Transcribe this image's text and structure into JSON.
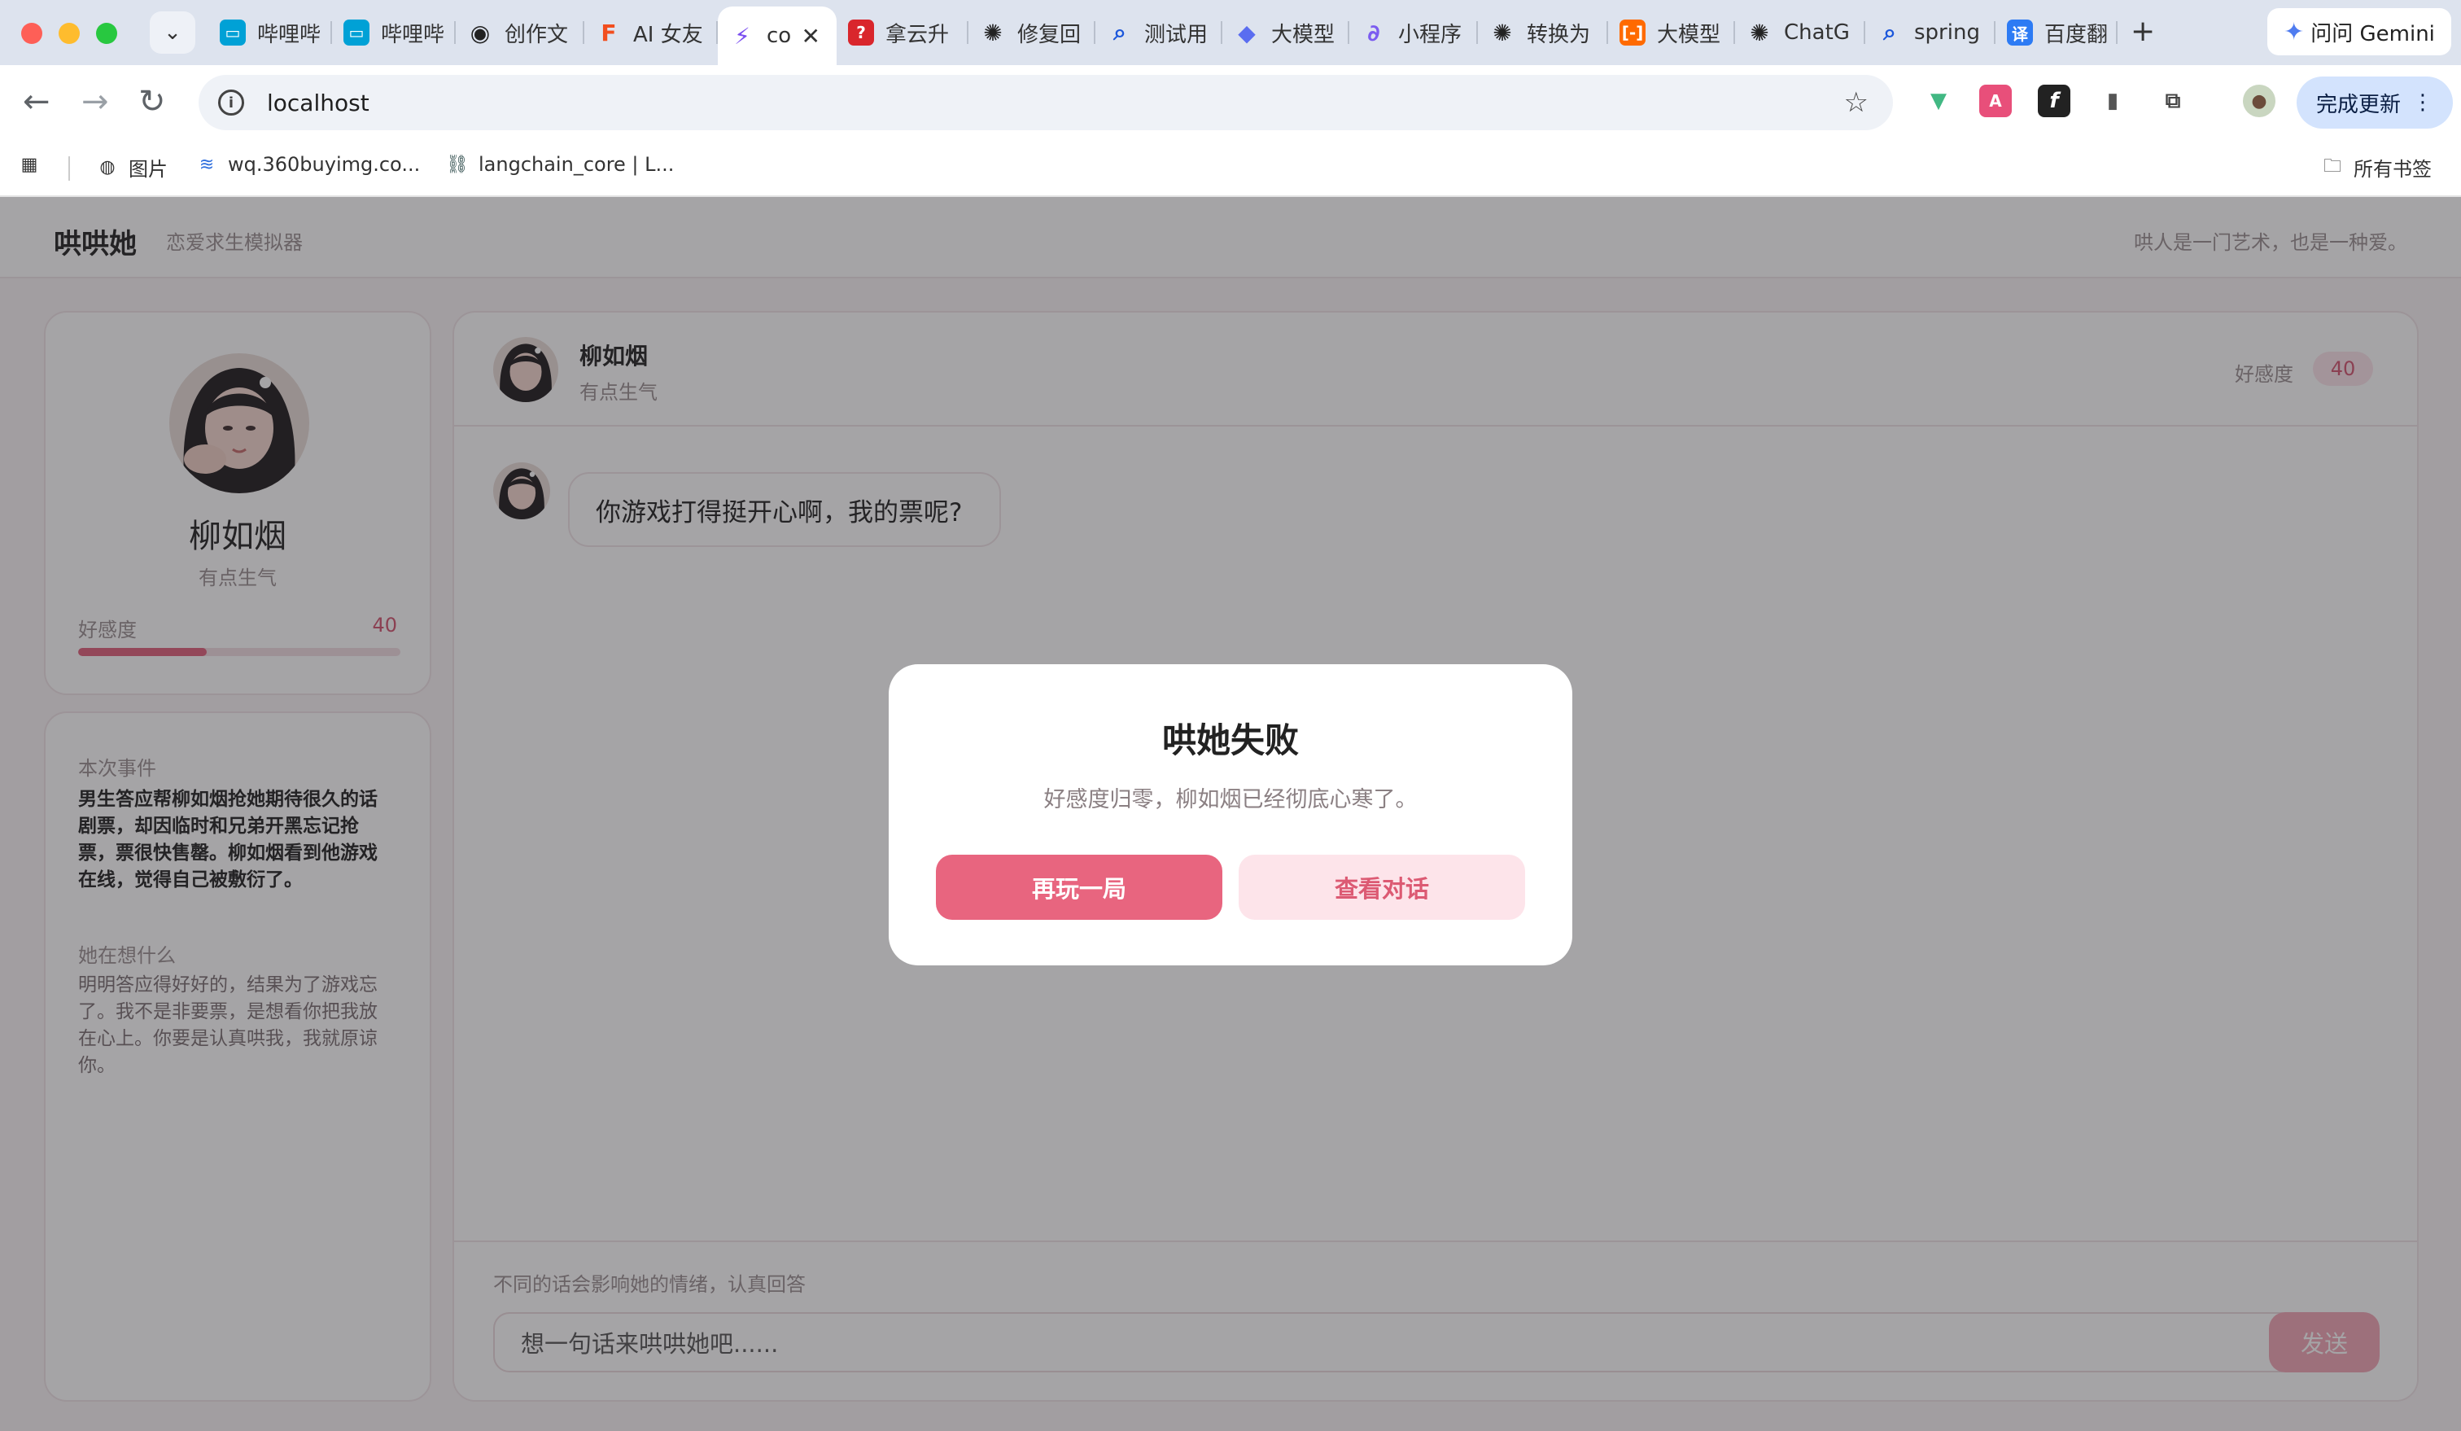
{
  "browser": {
    "tabs": [
      {
        "label": "哔哩哔",
        "icon": "bilibili-icon",
        "color": "#00a1d6"
      },
      {
        "label": "哔哩哔",
        "icon": "bilibili-icon",
        "color": "#00a1d6"
      },
      {
        "label": "创作文",
        "icon": "robot-icon",
        "color": "#222222"
      },
      {
        "label": "AI 女友",
        "icon": "figma-icon",
        "color": "#f24e1e"
      },
      {
        "label": "co",
        "icon": "bolt-icon",
        "color": "#7b4ff0"
      },
      {
        "label": "拿云升",
        "icon": "bookmark-red-icon",
        "color": "#d9262c"
      },
      {
        "label": "修复回",
        "icon": "openai-icon",
        "color": "#222222"
      },
      {
        "label": "测试用",
        "icon": "search-icon",
        "color": "#1a56db"
      },
      {
        "label": "大模型",
        "icon": "cube-icon",
        "color": "#5a6df0"
      },
      {
        "label": "小程序",
        "icon": "link-icon",
        "color": "#7b5cf0"
      },
      {
        "label": "转换为",
        "icon": "openai-icon",
        "color": "#222222"
      },
      {
        "label": "大模型",
        "icon": "bracket-icon",
        "color": "#ff6a00"
      },
      {
        "label": "ChatG",
        "icon": "openai-icon",
        "color": "#222222"
      },
      {
        "label": "spring",
        "icon": "search-icon",
        "color": "#1a56db"
      },
      {
        "label": "百度翻",
        "icon": "translate-icon",
        "color": "#2d7bf4"
      }
    ],
    "active_tab_index": 4,
    "gemini_label": "问问 Gemini",
    "url": "localhost",
    "update_label": "完成更新",
    "bookmarks": [
      {
        "label": "图片",
        "icon": "globe-icon"
      },
      {
        "label": "wq.360buyimg.co...",
        "icon": "layers-icon"
      },
      {
        "label": "langchain_core | L...",
        "icon": "langchain-icon"
      }
    ],
    "all_bookmarks_label": "所有书签"
  },
  "app": {
    "logo": "哄哄她",
    "subtitle": "恋爱求生模拟器",
    "slogan": "哄人是一门艺术，也是一种爱。"
  },
  "profile": {
    "name": "柳如烟",
    "mood": "有点生气",
    "affection_label": "好感度",
    "affection_value": "40",
    "affection_fraction": 0.4
  },
  "story": {
    "event_title": "本次事件",
    "event_lines": [
      "男生答应帮柳如烟抢她期待很久的话",
      "剧票，却因临时和兄弟开黑忘记抢",
      "票，票很快售罄。柳如烟看到他游戏",
      "在线，觉得自己被敷衍了。"
    ],
    "think_title": "她在想什么",
    "think_lines": [
      "明明答应得好好的，结果为了游戏忘",
      "了。我不是非要票，是想看你把我放",
      "在心上。你要是认真哄我，我就原谅",
      "你。"
    ]
  },
  "chat": {
    "name": "柳如烟",
    "mood": "有点生气",
    "affection_label": "好感度",
    "affection_value": "40",
    "message": "你游戏打得挺开心啊，我的票呢?",
    "hint": "不同的话会影响她的情绪，认真回答",
    "input_placeholder": "想一句话来哄哄她吧......",
    "send_label": "发送"
  },
  "modal": {
    "title": "哄她失败",
    "description": "好感度归零，柳如烟已经彻底心寒了。",
    "retry_label": "再玩一局",
    "view_label": "查看对话"
  }
}
